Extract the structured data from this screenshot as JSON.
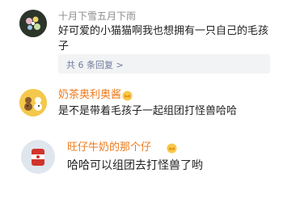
{
  "comments": [
    {
      "username": "十月下雪五月下雨",
      "text_line1": "好可爱的小猫猫啊我也想拥有一只自己的毛孩",
      "text_line2": "子",
      "replies_label": "共 6 条回复 >"
    },
    {
      "username": "奶茶奥利奥酱",
      "text": "是不是带着毛孩子一起组团打怪兽哈哈"
    },
    {
      "username": "旺仔牛奶的那个仔",
      "text": "哈哈可以组团去打怪兽了哟"
    }
  ],
  "colors": {
    "vip_name": "#f07a1a",
    "plain_name": "#8a8a8a",
    "reply_link": "#6e7a99",
    "reply_bg": "#f2f3f5"
  }
}
